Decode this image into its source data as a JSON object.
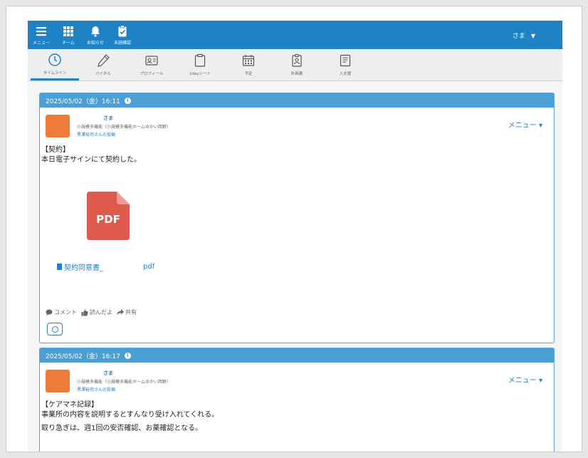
{
  "nav": {
    "items": [
      {
        "label": "メニュー",
        "icon": "hamburger-icon"
      },
      {
        "label": "チーム",
        "icon": "grid-icon"
      },
      {
        "label": "お知らせ",
        "icon": "bell-icon"
      },
      {
        "label": "未読確認",
        "icon": "clipboard-check-icon"
      }
    ],
    "user_label": "さま",
    "user_caret": "▼"
  },
  "tabs": [
    {
      "label": "タイムライン",
      "icon": "clock-icon",
      "active": true
    },
    {
      "label": "バイタル",
      "icon": "pen-icon",
      "active": false
    },
    {
      "label": "プロフィール",
      "icon": "id-card-icon",
      "active": false
    },
    {
      "label": "1dayシート",
      "icon": "clipboard-icon",
      "active": false
    },
    {
      "label": "予定",
      "icon": "calendar-icon",
      "active": false
    },
    {
      "label": "計画書",
      "icon": "badge-icon",
      "active": false
    },
    {
      "label": "入支援",
      "icon": "book-icon",
      "active": false
    }
  ],
  "posts": [
    {
      "datetime": "2025/05/02（金）16:11",
      "author_name": "さま",
      "author_org": "小規模多機能（小規模多機能ホームゆかい西野）",
      "author_post": "黒澤裕司さんの投稿",
      "menu_label": "メニュー ▾",
      "lines": [
        "【契約】",
        "本日電子サインにて契約した。"
      ],
      "pdf_label": "PDF",
      "attachment_name": "契約同意書_",
      "attachment_ext": "pdf",
      "actions": {
        "comment": "コメント",
        "like": "読んだよ",
        "share": "共有"
      }
    },
    {
      "datetime": "2025/05/02（金）16:17",
      "author_name": "さま",
      "author_org": "小規模多機能（小規模多機能ホームゆかい西野）",
      "author_post": "黒澤裕司さんの投稿",
      "menu_label": "メニュー ▾",
      "lines": [
        "【ケアマネ記録】",
        "事業所の内容を説明するとすんなり受け入れてくれる。",
        "取り急ぎは、週1回の安否確認、お薬確認となる。"
      ]
    }
  ],
  "colors": {
    "primary": "#1f82c4",
    "header": "#4a9fd5",
    "avatar": "#f07b38",
    "pdf": "#e05a4b"
  }
}
